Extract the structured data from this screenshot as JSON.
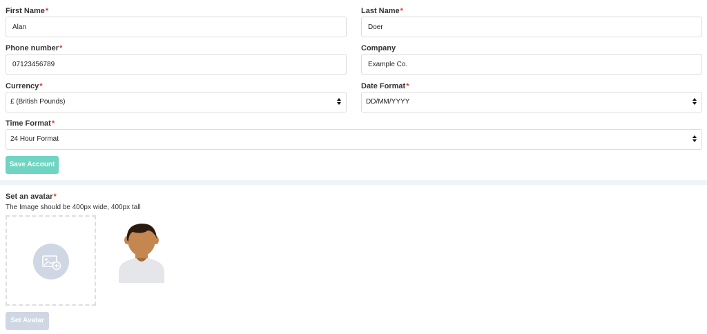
{
  "form": {
    "first_name": {
      "label": "First Name",
      "required": "*",
      "value": "Alan"
    },
    "last_name": {
      "label": "Last Name",
      "required": "*",
      "value": "Doer"
    },
    "phone": {
      "label": "Phone number",
      "required": "*",
      "value": "07123456789"
    },
    "company": {
      "label": "Company",
      "value": "Example Co."
    },
    "currency": {
      "label": "Currency",
      "required": "*",
      "selected": "£ (British Pounds)"
    },
    "date_format": {
      "label": "Date Format",
      "required": "*",
      "selected": "DD/MM/YYYY"
    },
    "time_format": {
      "label": "Time Format",
      "required": "*",
      "selected": "24 Hour Format"
    },
    "save_label": "Save Account"
  },
  "avatar_section": {
    "title": "Set an avatar",
    "required": "*",
    "hint": "The Image should be 400px wide, 400px tall",
    "dropzone_icon": "image-add-icon",
    "preview_icon": "default-avatar-icon",
    "set_label": "Set Avatar"
  },
  "colors": {
    "accent": "#6fd4c2",
    "required": "#e3342f",
    "disabled": "#cfd6e4",
    "divider": "#eef5fa"
  }
}
